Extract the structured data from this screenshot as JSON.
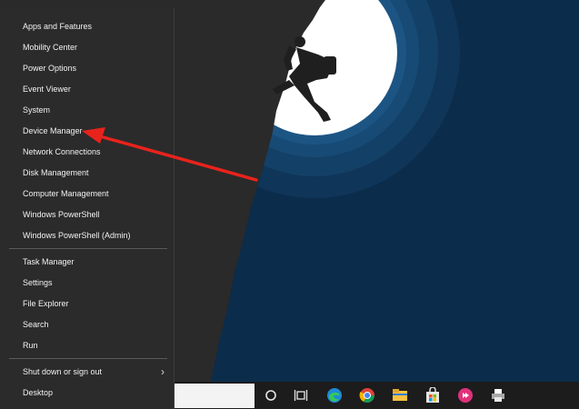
{
  "winx_menu": {
    "items": [
      {
        "label": "Apps and Features"
      },
      {
        "label": "Mobility Center"
      },
      {
        "label": "Power Options"
      },
      {
        "label": "Event Viewer"
      },
      {
        "label": "System"
      },
      {
        "label": "Device Manager"
      },
      {
        "label": "Network Connections"
      },
      {
        "label": "Disk Management"
      },
      {
        "label": "Computer Management"
      },
      {
        "label": "Windows PowerShell"
      },
      {
        "label": "Windows PowerShell (Admin)"
      },
      {
        "label": "Task Manager"
      },
      {
        "label": "Settings"
      },
      {
        "label": "File Explorer"
      },
      {
        "label": "Search"
      },
      {
        "label": "Run"
      },
      {
        "label": "Shut down or sign out"
      },
      {
        "label": "Desktop"
      }
    ]
  },
  "taskbar": {
    "icons": [
      "cortana-icon",
      "task-view-icon",
      "edge-icon",
      "chrome-icon",
      "file-explorer-icon",
      "store-icon",
      "app-icon",
      "printer-icon"
    ]
  },
  "colors": {
    "menu_bg": "#2b2b2b",
    "wallpaper_dark": "#0c2c4b",
    "moon": "#ffffff",
    "arrow": "#e8231c"
  }
}
